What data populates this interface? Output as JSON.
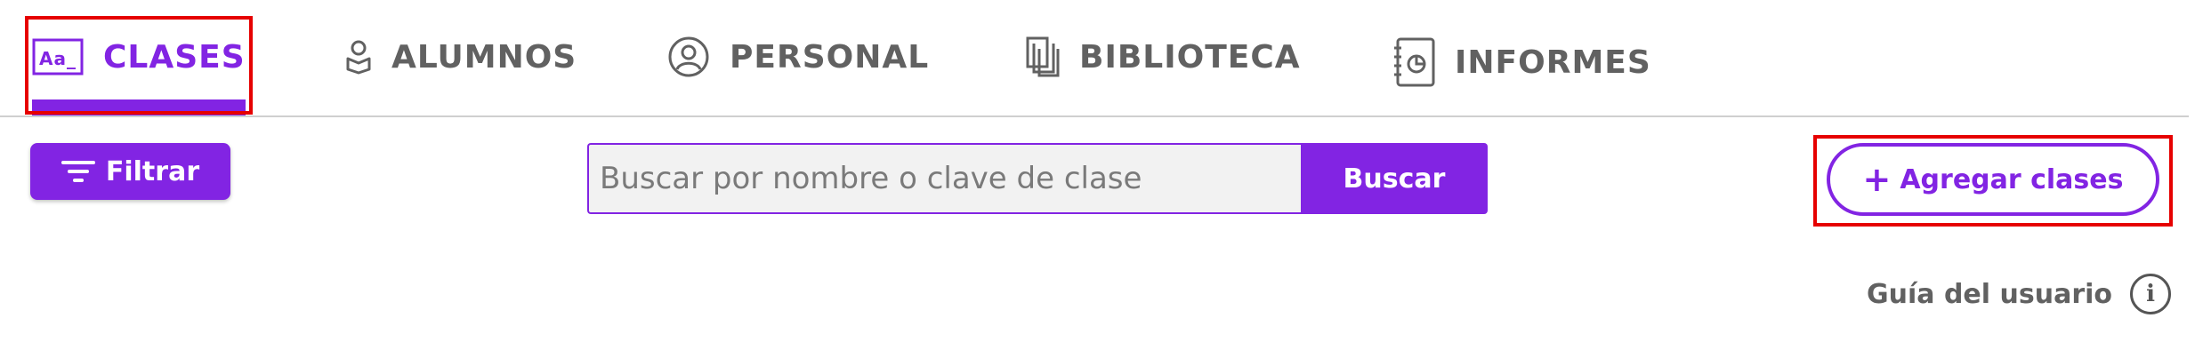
{
  "tabs": [
    {
      "label": "CLASES",
      "icon": "text-style-icon",
      "active": true
    },
    {
      "label": "ALUMNOS",
      "icon": "student-icon",
      "active": false
    },
    {
      "label": "PERSONAL",
      "icon": "user-circle-icon",
      "active": false
    },
    {
      "label": "BIBLIOTECA",
      "icon": "pages-copy-icon",
      "active": false
    },
    {
      "label": "INFORMES",
      "icon": "report-notebook-icon",
      "active": false
    }
  ],
  "toolbar": {
    "filter_label": "Filtrar",
    "search_placeholder": "Buscar por nombre o clave de clase",
    "search_value": "",
    "search_button": "Buscar",
    "add_label": "Agregar clases"
  },
  "guide": {
    "label": "Guía del usuario"
  },
  "colors": {
    "accent": "#8224e3",
    "highlight": "#e60000",
    "text": "#616161"
  }
}
